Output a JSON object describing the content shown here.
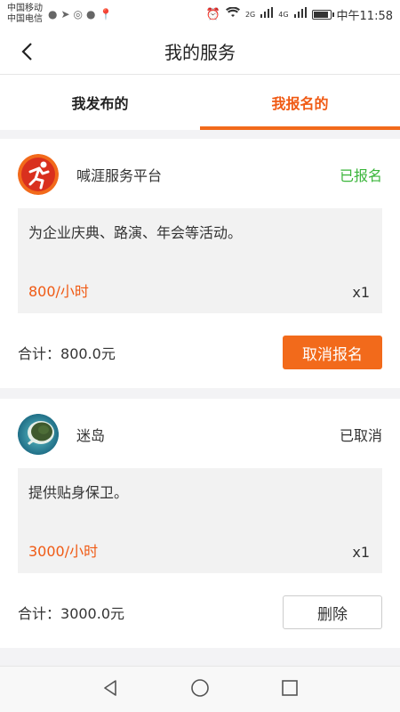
{
  "status_bar": {
    "carrier1": "中国移动",
    "carrier2": "中国电信",
    "time": "中午11:58",
    "network1": "2G",
    "network2": "4G"
  },
  "nav": {
    "title": "我的服务"
  },
  "tabs": [
    {
      "label": "我发布的",
      "active": false
    },
    {
      "label": "我报名的",
      "active": true
    }
  ],
  "cards": [
    {
      "org_name": "喊涯服务平台",
      "status": "已报名",
      "description": "为企业庆典、路演、年会等活动。",
      "price": "800/小时",
      "quantity": "x1",
      "total_label": "合计：",
      "total_value": "800.0元",
      "button_label": "取消报名"
    },
    {
      "org_name": "迷岛",
      "status": "已取消",
      "description": "提供贴身保卫。",
      "price": "3000/小时",
      "quantity": "x1",
      "total_label": "合计：",
      "total_value": "3000.0元",
      "button_label": "删除"
    }
  ],
  "colors": {
    "accent": "#f26a1b",
    "status_green": "#3ab53a"
  }
}
